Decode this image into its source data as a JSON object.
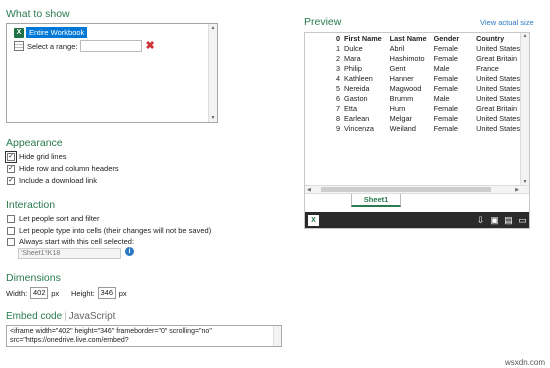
{
  "what_to_show": {
    "title": "What to show",
    "entire_workbook": "Entire Workbook",
    "select_range_label": "Select a range:",
    "select_range_value": ""
  },
  "appearance": {
    "title": "Appearance",
    "options": [
      {
        "label": "Hide grid lines",
        "checked": true
      },
      {
        "label": "Hide row and column headers",
        "checked": true
      },
      {
        "label": "Include a download link",
        "checked": true
      }
    ]
  },
  "interaction": {
    "title": "Interaction",
    "options": [
      {
        "label": "Let people sort and filter",
        "checked": false
      },
      {
        "label": "Let people type into cells (their changes will not be saved)",
        "checked": false
      },
      {
        "label": "Always start with this cell selected:",
        "checked": false
      }
    ],
    "cell_value": "'Sheet1'!K18"
  },
  "dimensions": {
    "title": "Dimensions",
    "width_label": "Width:",
    "width_value": "402",
    "width_unit": "px",
    "height_label": "Height:",
    "height_value": "346",
    "height_unit": "px"
  },
  "embed": {
    "tab_embed": "Embed code",
    "tab_separator": "|",
    "tab_js": "JavaScript",
    "code_line1": "<iframe width=\"402\" height=\"346\" frameborder=\"0\" scrolling=\"no\"",
    "code_line2": "src=\"https://onedrive.live.com/embed?"
  },
  "preview": {
    "title": "Preview",
    "view_actual_size": "View actual size",
    "sheet_tab": "Sheet1",
    "excel_glyph": "X",
    "header": {
      "num": "0",
      "first": "First Name",
      "last": "Last Name",
      "gender": "Gender",
      "country": "Country"
    },
    "rows": [
      {
        "num": "1",
        "first": "Dulce",
        "last": "Abril",
        "gender": "Female",
        "country": "United States"
      },
      {
        "num": "2",
        "first": "Mara",
        "last": "Hashimoto",
        "gender": "Female",
        "country": "Great Britain"
      },
      {
        "num": "3",
        "first": "Philip",
        "last": "Gent",
        "gender": "Male",
        "country": "France"
      },
      {
        "num": "4",
        "first": "Kathleen",
        "last": "Hanner",
        "gender": "Female",
        "country": "United States"
      },
      {
        "num": "5",
        "first": "Nereida",
        "last": "Magwood",
        "gender": "Female",
        "country": "United States"
      },
      {
        "num": "6",
        "first": "Gaston",
        "last": "Brumm",
        "gender": "Male",
        "country": "United States"
      },
      {
        "num": "7",
        "first": "Etta",
        "last": "Hurn",
        "gender": "Female",
        "country": "Great Britain"
      },
      {
        "num": "8",
        "first": "Earlean",
        "last": "Melgar",
        "gender": "Female",
        "country": "United States"
      },
      {
        "num": "9",
        "first": "Vincenza",
        "last": "Weiland",
        "gender": "Female",
        "country": "United States"
      }
    ]
  },
  "watermark": "wsxdn.com",
  "colors": {
    "accent": "#2a7a4f",
    "link": "#2b79c2",
    "selection": "#0078d7",
    "excel_green": "#1e7145"
  }
}
